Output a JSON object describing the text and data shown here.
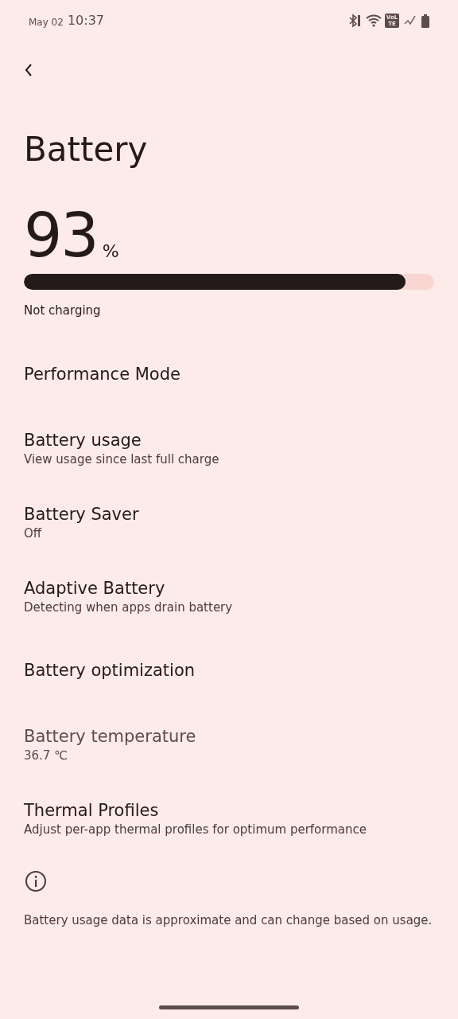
{
  "status_bar": {
    "date": "May 02",
    "time": "10:37",
    "volte_badge": "VoLTE"
  },
  "title": "Battery",
  "battery": {
    "percent": "93",
    "unit": "%",
    "level": 0.93,
    "status": "Not charging"
  },
  "items": [
    {
      "title": "Performance Mode",
      "disabled": false
    },
    {
      "title": "Battery usage",
      "summary": "View usage since last full charge",
      "disabled": false
    },
    {
      "title": "Battery Saver",
      "summary": "Off",
      "disabled": false
    },
    {
      "title": "Adaptive Battery",
      "summary": "Detecting when apps drain battery",
      "disabled": false
    },
    {
      "title": "Battery optimization",
      "disabled": false
    },
    {
      "title": "Battery temperature",
      "summary": "36.7 ℃",
      "disabled": true
    },
    {
      "title": "Thermal Profiles",
      "summary": "Adjust per-app thermal profiles for optimum performance",
      "disabled": false
    }
  ],
  "footer": "Battery usage data is approximate and can change based on usage."
}
